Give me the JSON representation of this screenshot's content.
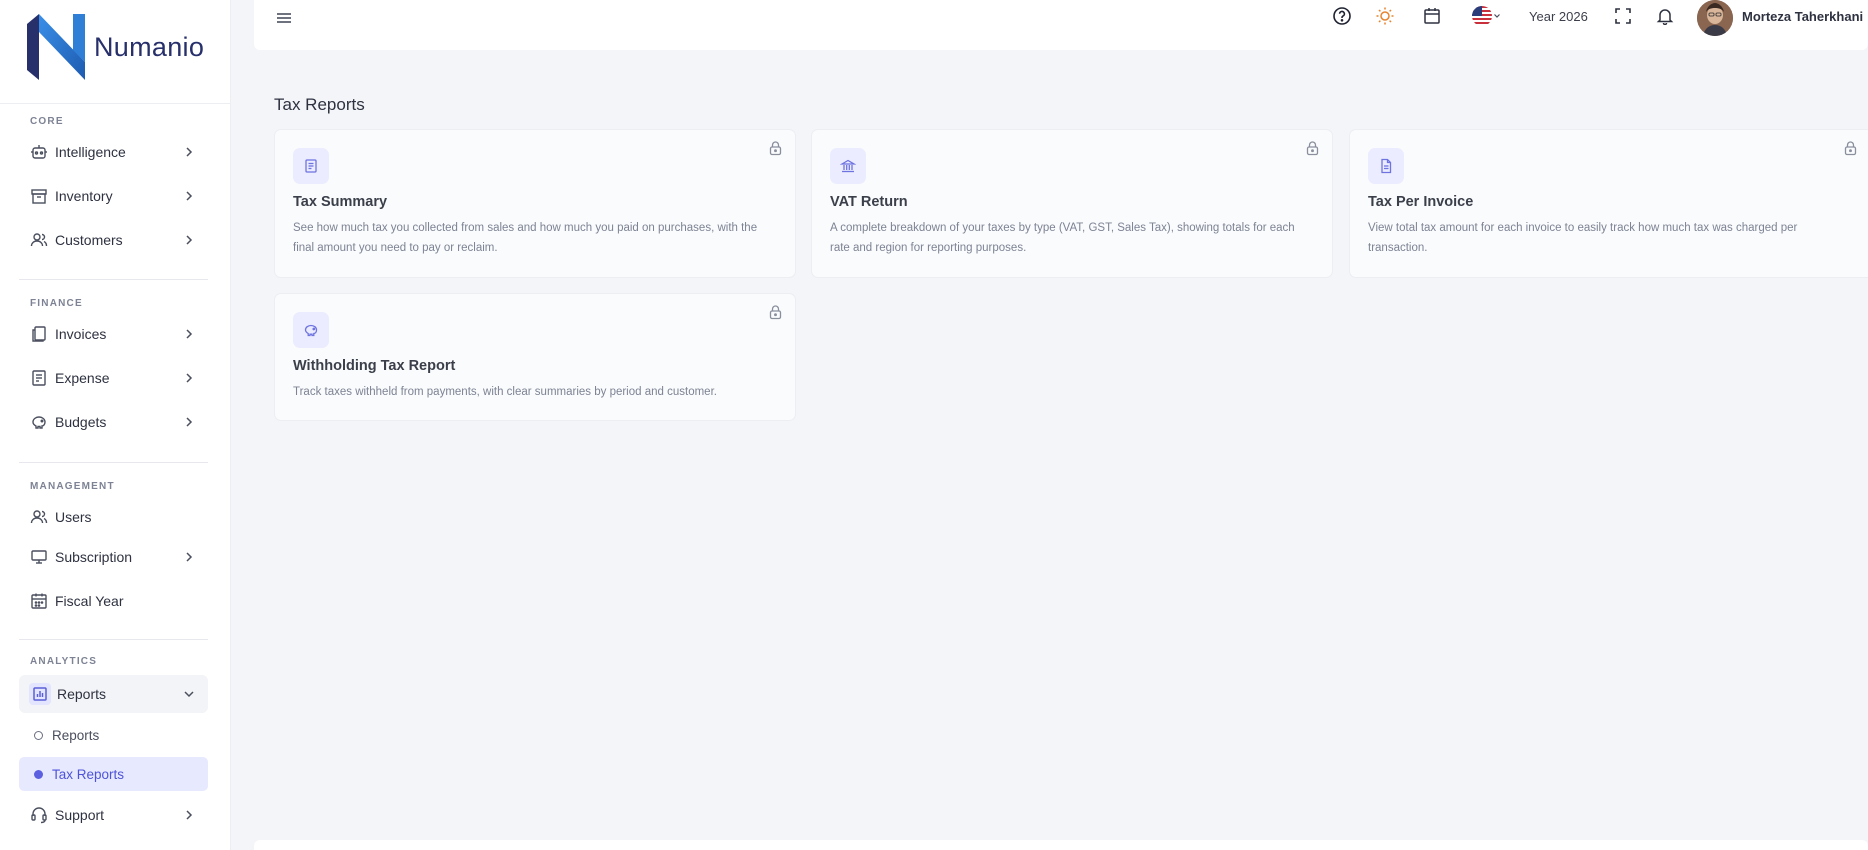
{
  "brand": {
    "name": "Numanio"
  },
  "sidebar": {
    "sections": [
      {
        "title": "CORE"
      },
      {
        "title": "FINANCE"
      },
      {
        "title": "MANAGEMENT"
      },
      {
        "title": "ANALYTICS"
      }
    ],
    "items": {
      "intelligence": "Intelligence",
      "inventory": "Inventory",
      "customers": "Customers",
      "invoices": "Invoices",
      "expense": "Expense",
      "budgets": "Budgets",
      "users": "Users",
      "subscription": "Subscription",
      "fiscal_year": "Fiscal Year",
      "reports": "Reports",
      "reports_sub": "Reports",
      "tax_reports_sub": "Tax Reports",
      "support": "Support"
    }
  },
  "topbar": {
    "year": "Year 2026",
    "user_name": "Morteza Taherkhani"
  },
  "page": {
    "title": "Tax Reports",
    "cards": [
      {
        "title": "Tax Summary",
        "desc": "See how much tax you collected from sales and how much you paid on purchases, with the final amount you need to pay or reclaim."
      },
      {
        "title": "VAT Return",
        "desc": "A complete breakdown of your taxes by type (VAT, GST, Sales Tax), showing totals for each rate and region for reporting purposes."
      },
      {
        "title": "Tax Per Invoice",
        "desc": "View total tax amount for each invoice to easily track how much tax was charged per transaction."
      },
      {
        "title": "Withholding Tax Report",
        "desc": "Track taxes withheld from payments, with clear summaries by period and customer."
      }
    ]
  },
  "colors": {
    "accent": "#5b5fe0",
    "brand_navy": "#27306b",
    "brand_blue": "#2f7fd6"
  }
}
